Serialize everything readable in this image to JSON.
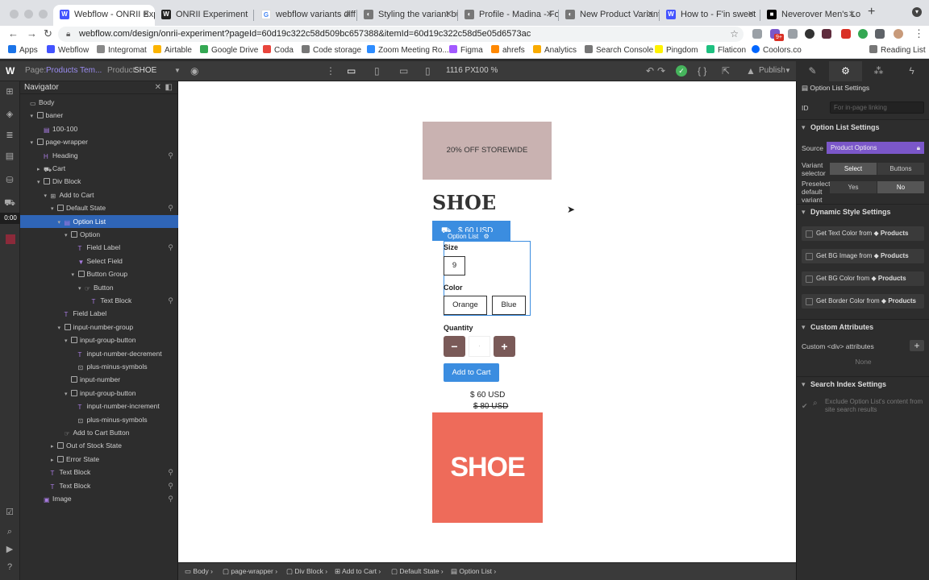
{
  "browser": {
    "tabs": [
      {
        "label": "Webflow - ONRII Exp",
        "active": true
      },
      {
        "label": "ONRII Experiment"
      },
      {
        "label": "webflow variants diff"
      },
      {
        "label": "Styling the variant bu"
      },
      {
        "label": "Profile - Madina - Fo"
      },
      {
        "label": "New Product Variant"
      },
      {
        "label": "How to - F'in sweet"
      },
      {
        "label": "Neverover Men's Lon"
      }
    ],
    "url": "webflow.com/design/onrii-experiment?pageId=60d19c322c58d509bc657388&itemId=60d19c322c58d5e05d6573ac",
    "bookmarks": [
      "Apps",
      "Webflow",
      "Integromat",
      "Airtable",
      "Google Drive",
      "Coda",
      "Code storage",
      "Zoom Meeting Ro...",
      "Figma",
      "ahrefs",
      "Analytics",
      "Search Console",
      "Pingdom",
      "Flaticon",
      "Coolors.co"
    ],
    "reading_list": "Reading List",
    "ext_badge": "9+"
  },
  "toolbar": {
    "page_label": "Page:",
    "page_value": "Products Tem...",
    "product_label": "Product:",
    "product_value": "SHOE",
    "width": "1116 PX",
    "zoom": "100 %",
    "publish": "Publish"
  },
  "navigator": {
    "title": "Navigator",
    "items": [
      {
        "label": "Body",
        "depth": 0
      },
      {
        "label": "baner",
        "depth": 1
      },
      {
        "label": "100-100",
        "depth": 2
      },
      {
        "label": "page-wrapper",
        "depth": 1
      },
      {
        "label": "Heading",
        "depth": 2
      },
      {
        "label": "Cart",
        "depth": 2
      },
      {
        "label": "Div Block",
        "depth": 2
      },
      {
        "label": "Add to Cart",
        "depth": 3
      },
      {
        "label": "Default State",
        "depth": 4
      },
      {
        "label": "Option List",
        "depth": 5,
        "selected": true
      },
      {
        "label": "Option",
        "depth": 6
      },
      {
        "label": "Field Label",
        "depth": 7
      },
      {
        "label": "Select Field",
        "depth": 7
      },
      {
        "label": "Button Group",
        "depth": 7
      },
      {
        "label": "Button",
        "depth": 8
      },
      {
        "label": "Text Block",
        "depth": 9
      },
      {
        "label": "Field Label",
        "depth": 5
      },
      {
        "label": "input-number-group",
        "depth": 5
      },
      {
        "label": "input-group-button",
        "depth": 6
      },
      {
        "label": "input-number-decrement",
        "depth": 7
      },
      {
        "label": "plus-minus-symbols",
        "depth": 7
      },
      {
        "label": "input-number",
        "depth": 6
      },
      {
        "label": "input-group-button",
        "depth": 6
      },
      {
        "label": "input-number-increment",
        "depth": 7
      },
      {
        "label": "plus-minus-symbols",
        "depth": 7
      },
      {
        "label": "Add to Cart Button",
        "depth": 5
      },
      {
        "label": "Out of Stock State",
        "depth": 4
      },
      {
        "label": "Error State",
        "depth": 4
      },
      {
        "label": "Text Block",
        "depth": 3
      },
      {
        "label": "Text Block",
        "depth": 3
      },
      {
        "label": "Image",
        "depth": 2
      }
    ]
  },
  "canvas": {
    "promo": "20% OFF STOREWIDE",
    "product_title": "SHOE",
    "add_bar_price": "$ 60 USD",
    "option_list_tag": "Option List",
    "size_label": "Size",
    "size_option": "9",
    "color_label": "Color",
    "color_options": [
      "Orange",
      "Blue"
    ],
    "quantity_label": "Quantity",
    "minus": "−",
    "plus": "+",
    "qty_value": "·",
    "add_to_cart": "Add to Cart",
    "price": "$ 60 USD",
    "old_price": "$ 80 USD",
    "image_text": "SHOE"
  },
  "breadcrumbs": [
    "Body",
    "page-wrapper",
    "Div Block",
    "Add to Cart",
    "Default State",
    "Option List"
  ],
  "timer": "0:00",
  "settings": {
    "header": "Option List Settings",
    "id_label": "ID",
    "id_placeholder": "For in-page linking",
    "section_option_list": "Option List Settings",
    "source_label": "Source",
    "source_value": "Product Options",
    "variant_selector_label": "Variant selector",
    "select": "Select",
    "buttons": "Buttons",
    "preselect_label": "Preselect default variant",
    "yes": "Yes",
    "no": "No",
    "section_dynamic": "Dynamic Style Settings",
    "dynamic": [
      "Get Text Color from",
      "Get BG Image from",
      "Get BG Color from",
      "Get Border Color from"
    ],
    "products": "Products",
    "section_custom": "Custom Attributes",
    "custom_div_label": "Custom <div> attributes",
    "none": "None",
    "section_search": "Search Index Settings",
    "exclude_text": "Exclude Option List's content from site search results"
  },
  "colors": {
    "accent": "#3b8de0",
    "selected": "#2f65b7",
    "promo": "#c9b2b1",
    "image": "#ee6b5a",
    "stepper": "#7a5a58",
    "source": "#7b57c9"
  }
}
